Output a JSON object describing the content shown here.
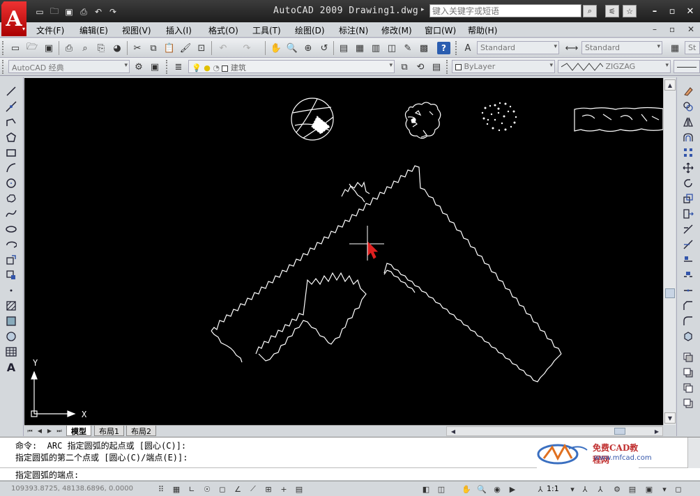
{
  "app": {
    "logo_letter": "A",
    "window_title": "AutoCAD 2009 Drawing1.dwg",
    "search_placeholder": "键入关键字或短语"
  },
  "menu": {
    "items": [
      "文件(F)",
      "编辑(E)",
      "视图(V)",
      "插入(I)",
      "格式(O)",
      "工具(T)",
      "绘图(D)",
      "标注(N)",
      "修改(M)",
      "窗口(W)",
      "帮助(H)"
    ]
  },
  "toolbar": {
    "text_style": "Standard",
    "dim_style": "Standard",
    "table_style_partial": "St",
    "workspace": "AutoCAD 经典",
    "layer": "建筑",
    "color": "ByLayer",
    "linetype": "ZIGZAG"
  },
  "canvas": {
    "background": "#000000",
    "ucs_x": "X",
    "ucs_y": "Y",
    "cursor_color": "#e02020"
  },
  "tabs": [
    "模型",
    "布局1",
    "布局2"
  ],
  "command": {
    "line1": "命令:  ARC 指定圆弧的起点或 [圆心(C)]:",
    "line2": "指定圆弧的第二个点或 [圆心(C)/端点(E)]:",
    "line3": "指定圆弧的端点:"
  },
  "watermark": {
    "title": "免费CAD教程网",
    "url": "www.mfcad.com"
  },
  "status": {
    "coordinates": "109393.8725, 48138.6896, 0.0000",
    "annotation_scale": "1:1"
  }
}
